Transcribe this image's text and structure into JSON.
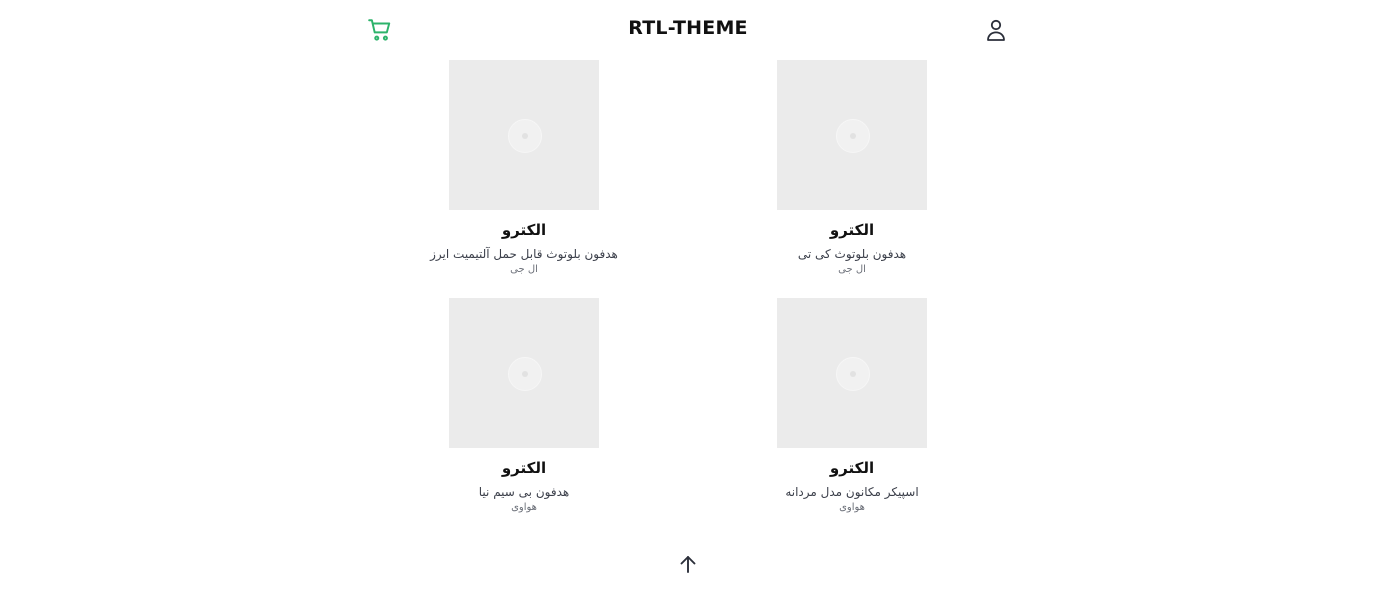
{
  "header": {
    "title": "RTL-THEME",
    "cart_icon": "cart-icon",
    "user_icon": "user-icon",
    "accent_color": "#2db36b"
  },
  "products": [
    {
      "category": "الکترو",
      "name": "هدفون بلوتوث قابل حمل آلتیمیت ایرز",
      "brand": "ال جی"
    },
    {
      "category": "الکترو",
      "name": "هدفون بلوتوث کی تی",
      "brand": "ال جی"
    },
    {
      "category": "الکترو",
      "name": "هدفون بی سیم نیا",
      "brand": "هواوی"
    },
    {
      "category": "الکترو",
      "name": "اسپیکر مکانون مدل مردانه",
      "brand": "هواوی"
    }
  ],
  "footer": {
    "scroll_top_icon": "arrow-up-icon"
  }
}
